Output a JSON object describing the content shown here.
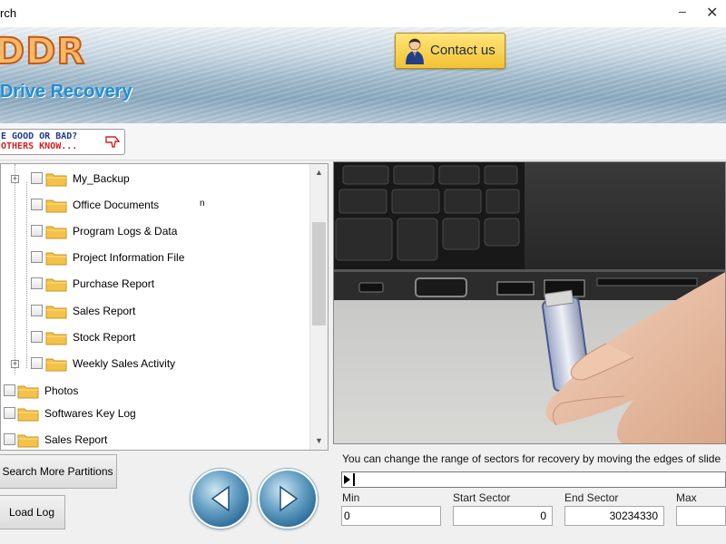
{
  "window": {
    "title": "rch",
    "minimize": "–",
    "close": "✕"
  },
  "header": {
    "logo": "DDR",
    "subtitle": "Drive Recovery",
    "contact_label": "Contact us"
  },
  "rating": {
    "line1": "E GOOD OR BAD?",
    "line2": "OTHERS KNOW..."
  },
  "tree": {
    "items": [
      {
        "label": "My_Backup",
        "expandable": true
      },
      {
        "label": "Office Documents",
        "expandable": false
      },
      {
        "label": "Program Logs & Data",
        "expandable": false
      },
      {
        "label": "Project Information File",
        "expandable": false
      },
      {
        "label": "Purchase Report",
        "expandable": false
      },
      {
        "label": "Sales Report",
        "expandable": false
      },
      {
        "label": "Stock Report",
        "expandable": false
      },
      {
        "label": "Weekly Sales Activity",
        "expandable": true
      },
      {
        "label": "Photos",
        "expandable": false
      },
      {
        "label": "Softwares Key Log",
        "expandable": false
      },
      {
        "label": "Sales Report",
        "expandable": false
      }
    ],
    "stray_mark": "n"
  },
  "sector": {
    "hint": "You can change the range of sectors for recovery by moving the edges of slide",
    "min_label": "Min",
    "min_value": "0",
    "start_label": "Start Sector",
    "start_value": "0",
    "end_label": "End Sector",
    "end_value": "30234330",
    "max_label": "Max",
    "max_value": ""
  },
  "buttons": {
    "search_more": "Search More Partitions",
    "load_log": "Load Log"
  },
  "icons": {
    "contact": "person-icon",
    "rating": "thumb-down-icon",
    "folder": "folder-icon",
    "back": "arrow-left-icon",
    "next": "arrow-right-icon"
  },
  "colors": {
    "logo_fill": "#f7b86a",
    "logo_stroke": "#c65a12",
    "subtitle": "#1f8fd6",
    "contact_button": "#f2c232",
    "nav_button": "#2f6f9c"
  }
}
